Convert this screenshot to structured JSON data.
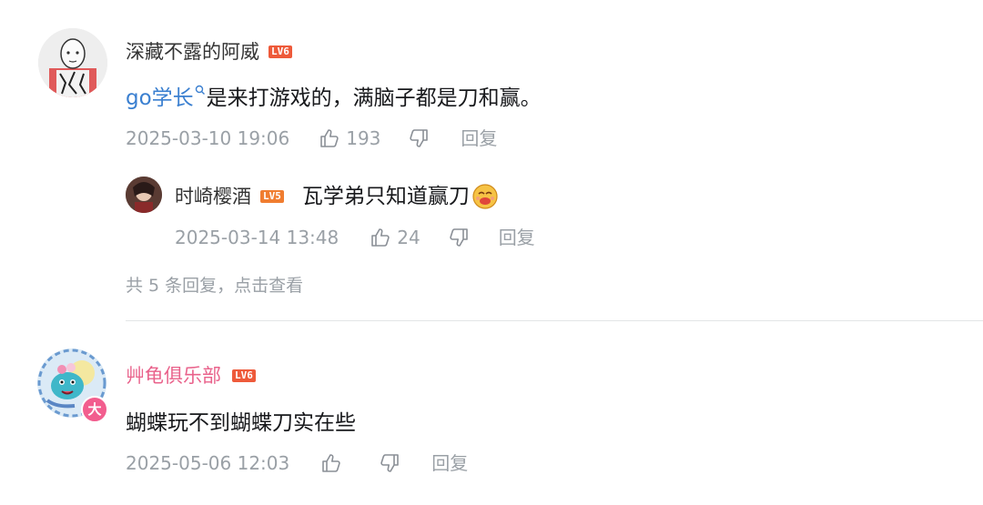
{
  "comments": [
    {
      "username": "深藏不露的阿威",
      "level": "LV6",
      "tag": "go学长",
      "text": "是来打游戏的，满脑子都是刀和赢。",
      "time": "2025-03-10 19:06",
      "likes": "193",
      "reply_label": "回复",
      "replies": [
        {
          "username": "时崎樱酒",
          "level": "LV5",
          "text": "瓦学弟只知道赢刀",
          "time": "2025-03-14 13:48",
          "likes": "24",
          "reply_label": "回复"
        }
      ],
      "more_replies": "共 5 条回复，点击查看"
    },
    {
      "username": "艸龟俱乐部",
      "level": "LV6",
      "avatar_badge": "大",
      "text": "蝴蝶玩不到蝴蝶刀实在些",
      "time": "2025-05-06 12:03",
      "reply_label": "回复"
    }
  ],
  "colors": {
    "level6": "#ee5a3a",
    "level5": "#f07d30",
    "link": "#3a7fd0",
    "pink_name": "#e9628b",
    "meta": "#9aa0a6"
  },
  "icons": [
    "search-icon",
    "thumb-up-icon",
    "thumb-down-icon",
    "emoji-icon",
    "vip-badge-icon"
  ]
}
